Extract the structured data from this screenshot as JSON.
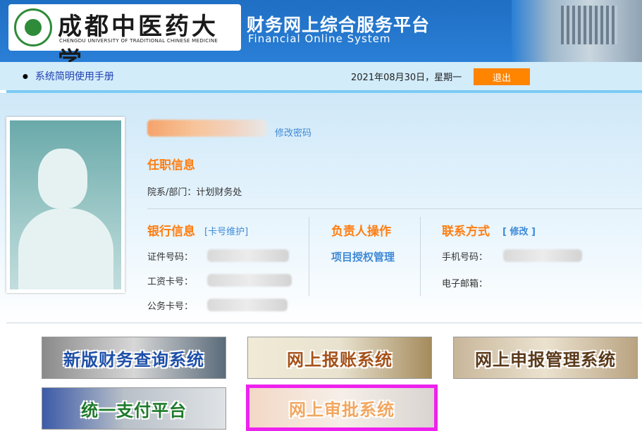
{
  "header": {
    "school_name_cn": "成都中医药大学",
    "school_name_en": "CHENGDU UNIVERSITY OF TRADITIONAL CHINESE MEDICINE",
    "system_title_cn": "财务网上综合服务平台",
    "system_title_en": "Financial Online System"
  },
  "topbar": {
    "manual_link": "系统简明使用手册",
    "date_text": "2021年08月30日，星期一",
    "logout_label": "退出"
  },
  "profile": {
    "change_password": "修改密码",
    "job_section": "任职信息",
    "dept_label": "院系/部门：",
    "dept_value": "计划财务处"
  },
  "bank": {
    "title": "银行信息",
    "maintain_link": "[卡号维护]",
    "id_label": "证件号码：",
    "salary_card_label": "工资卡号：",
    "business_card_label": "公务卡号："
  },
  "leader": {
    "title": "负责人操作",
    "auth_link": "项目授权管理"
  },
  "contact": {
    "title": "联系方式",
    "edit_link": "[ 修改 ]",
    "phone_label": "手机号码：",
    "email_label": "电子邮箱："
  },
  "systems": [
    {
      "label": "新版财务查询系统"
    },
    {
      "label": "网上报账系统"
    },
    {
      "label": "网上申报管理系统"
    },
    {
      "label": "统一支付平台"
    },
    {
      "label": "网上审批系统"
    }
  ],
  "colors": {
    "header_blue": "#2a7fd6",
    "accent_orange": "#ff7d10",
    "logout_orange": "#ff8400",
    "link_blue": "#3f8ad6",
    "highlight_magenta": "#ee22ee"
  }
}
